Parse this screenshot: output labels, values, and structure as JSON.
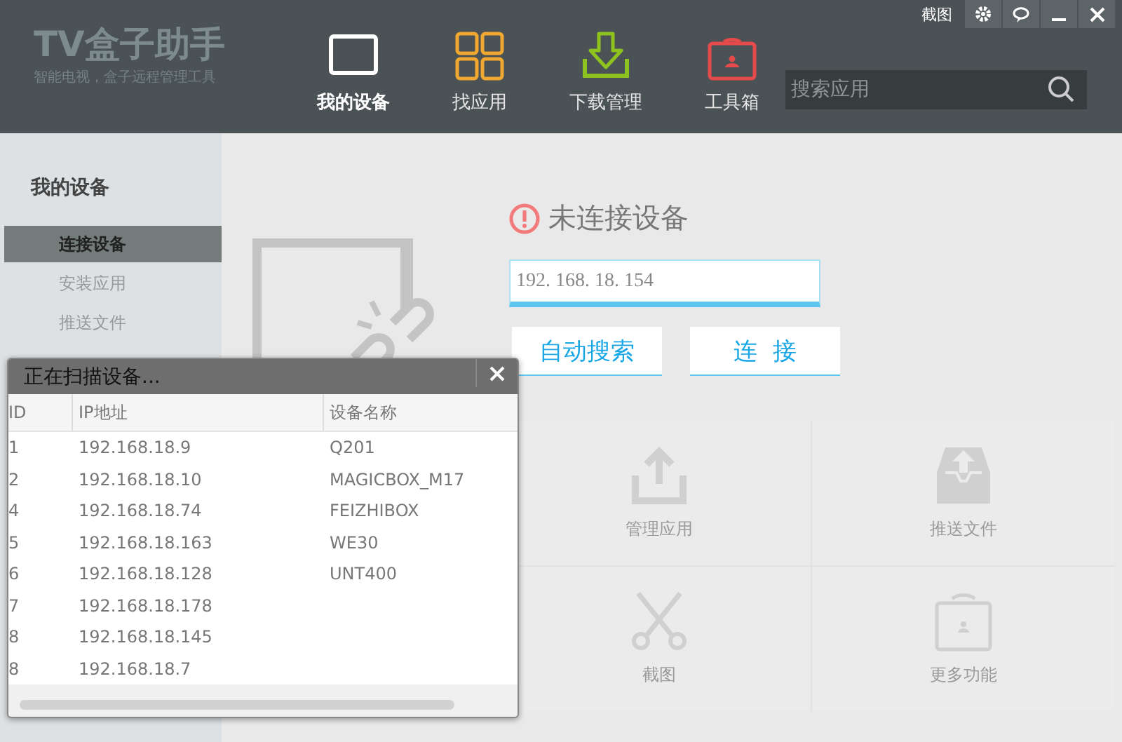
{
  "app": {
    "title": "TV盒子助手",
    "subtitle": "智能电视，盒子远程管理工具"
  },
  "window_controls": [
    {
      "kind": "text",
      "label": "截图"
    },
    {
      "kind": "settings"
    },
    {
      "kind": "chat"
    },
    {
      "kind": "minimize"
    },
    {
      "kind": "close"
    }
  ],
  "nav_tabs": [
    {
      "label": "我的设备",
      "kind": "device",
      "color": "#ffffff",
      "selected": true
    },
    {
      "label": "找应用",
      "kind": "apps",
      "color": "#f0a830",
      "selected": false
    },
    {
      "label": "下载管理",
      "kind": "download",
      "color": "#8dc21f",
      "selected": false
    },
    {
      "label": "工具箱",
      "kind": "toolbox",
      "color": "#e54b4b",
      "selected": false
    }
  ],
  "search": {
    "placeholder": "搜索应用"
  },
  "sidebar": {
    "title": "我的设备",
    "items": [
      {
        "label": "连接设备",
        "selected": true
      },
      {
        "label": "安装应用",
        "selected": false
      },
      {
        "label": "推送文件",
        "selected": false
      }
    ]
  },
  "connect": {
    "status": "未连接设备",
    "ip_value": "192. 168. 18. 154",
    "buttons": [
      "自动搜索",
      "连  接"
    ]
  },
  "tools": [
    {
      "label": "管理应用",
      "kind": "upload"
    },
    {
      "label": "推送文件",
      "kind": "inbox"
    },
    {
      "label": "截图",
      "kind": "scissors"
    },
    {
      "label": "更多功能",
      "kind": "toolbox"
    }
  ],
  "scan_dialog": {
    "title": "正在扫描设备...",
    "columns": [
      "ID",
      "IP地址",
      "设备名称"
    ],
    "rows": [
      [
        "1",
        "192.168.18.9",
        "Q201"
      ],
      [
        "2",
        "192.168.18.10",
        "MAGICBOX_M17"
      ],
      [
        "4",
        "192.168.18.74",
        "FEIZHIBOX"
      ],
      [
        "5",
        "192.168.18.163",
        "WE30"
      ],
      [
        "6",
        "192.168.18.128",
        "UNT400"
      ],
      [
        "7",
        "192.168.18.178",
        ""
      ],
      [
        "8",
        "192.168.18.145",
        ""
      ],
      [
        "8",
        "192.168.18.7",
        ""
      ]
    ]
  }
}
